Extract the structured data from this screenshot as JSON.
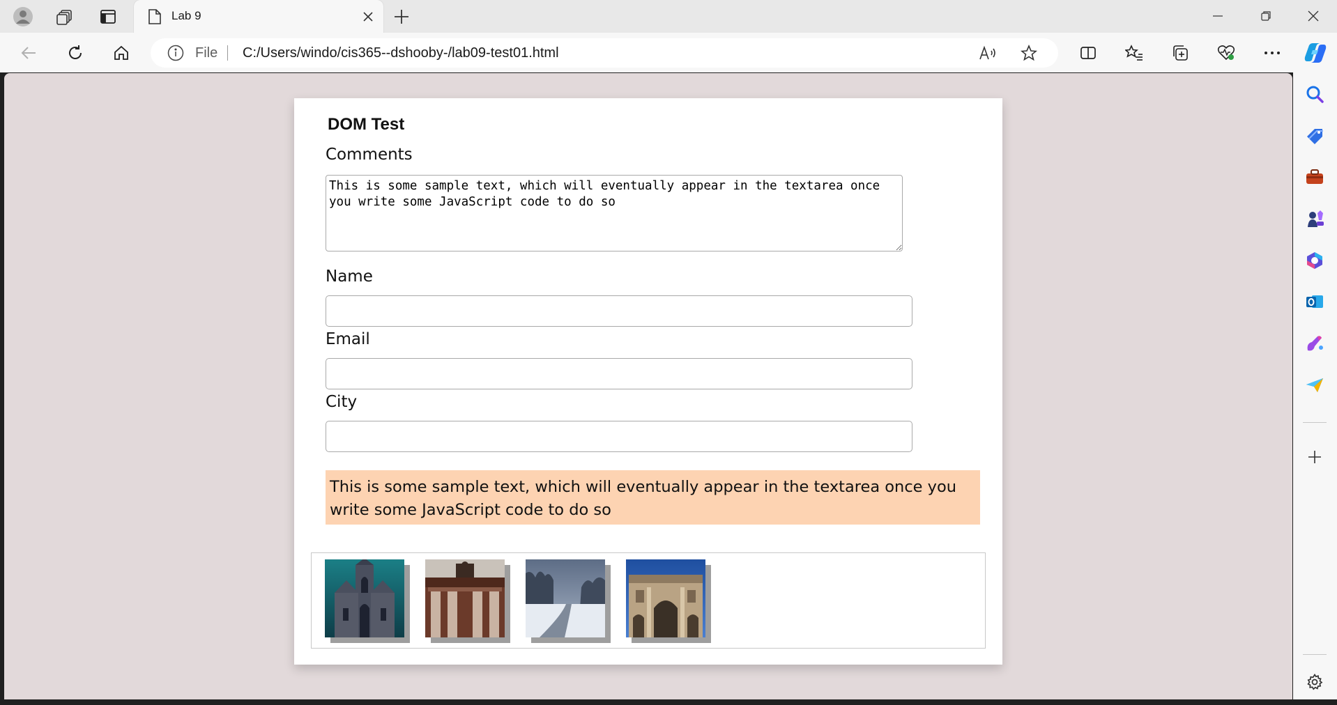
{
  "browser": {
    "tab": {
      "title": "Lab 9"
    },
    "address_bar": {
      "scheme_label": "File",
      "url": "C:/Users/windo/cis365--dshooby-/lab09-test01.html"
    }
  },
  "page": {
    "title": "DOM Test",
    "comments": {
      "label": "Comments",
      "value": "This is some sample text, which will eventually appear in the textarea once you write some JavaScript code to do so"
    },
    "name": {
      "label": "Name",
      "value": ""
    },
    "email": {
      "label": "Email",
      "value": ""
    },
    "city": {
      "label": "City",
      "value": ""
    },
    "output_text": "This is some sample text, which will eventually appear in the textarea once you write some JavaScript code to do so",
    "gallery": {
      "thumbnails": [
        {
          "subject": "gothic-church-photo"
        },
        {
          "subject": "city-gate-arch-photo"
        },
        {
          "subject": "snowy-road-photo"
        },
        {
          "subject": "triumphal-arch-photo"
        }
      ]
    }
  },
  "colors": {
    "viewport_background": "#e2d9da",
    "output_background": "#fdd3b2",
    "chrome_background": "#f7f7f7",
    "tabstrip_background": "#e8e8e8"
  },
  "icons": {
    "tabbar": [
      "profile-icon",
      "workspaces-icon",
      "vertical-tabs-icon",
      "page-icon",
      "close-icon",
      "plus-icon",
      "minimize-icon",
      "restore-icon",
      "window-close-icon"
    ],
    "toolbar": [
      "back-icon",
      "refresh-icon",
      "home-icon",
      "info-icon",
      "read-aloud-icon",
      "favorite-star-icon",
      "split-screen-icon",
      "favorites-icon",
      "collections-icon",
      "browser-essentials-icon",
      "more-icon",
      "copilot-icon"
    ],
    "sidebar": [
      "search-icon",
      "shopping-tag-icon",
      "tools-icon",
      "games-icon",
      "microsoft365-icon",
      "outlook-icon",
      "designer-icon",
      "send-icon",
      "add-icon",
      "settings-icon"
    ]
  }
}
